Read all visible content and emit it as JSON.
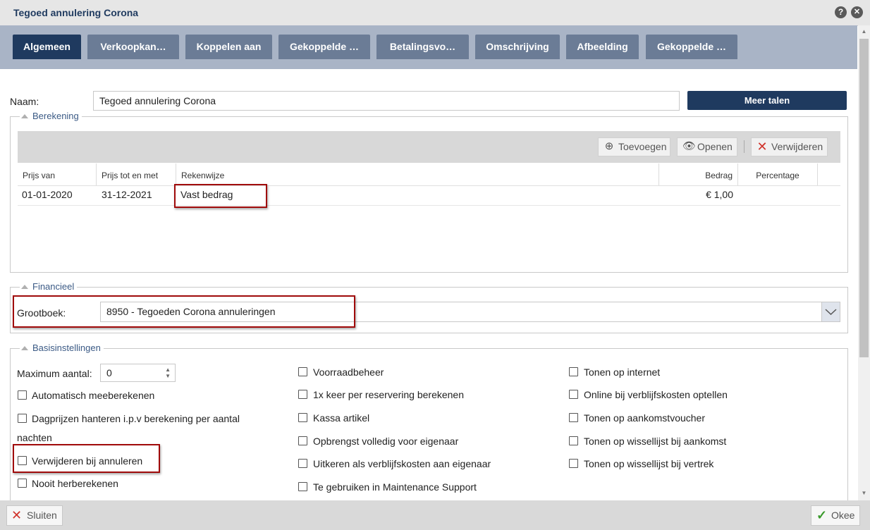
{
  "window": {
    "title": "Tegoed annulering Corona",
    "help_glyph": "?",
    "close_glyph": "✕"
  },
  "tabs": [
    "Algemeen",
    "Verkoopkan…",
    "Koppelen aan",
    "Gekoppelde …",
    "Betalingsvo…",
    "Omschrijving",
    "Afbeelding",
    "Gekoppelde …"
  ],
  "naam": {
    "label": "Naam:",
    "value": "Tegoed annulering Corona",
    "more_languages": "Meer talen"
  },
  "berekening": {
    "legend": "Berekening",
    "toolbar": {
      "add": "Toevoegen",
      "open": "Openen",
      "delete": "Verwijderen"
    },
    "columns": [
      "Prijs van",
      "Prijs tot en met",
      "Rekenwijze",
      "Bedrag",
      "Percentage"
    ],
    "rows": [
      {
        "from": "01-01-2020",
        "to": "31-12-2021",
        "method": "Vast bedrag",
        "amount": "€ 1,00",
        "percentage": ""
      }
    ]
  },
  "financieel": {
    "legend": "Financieel",
    "label": "Grootboek:",
    "value": "8950 - Tegoeden Corona annuleringen"
  },
  "basis": {
    "legend": "Basisinstellingen",
    "max_label": "Maximum aantal:",
    "max_value": "0",
    "col1": [
      "Automatisch meeberekenen",
      "Dagprijzen hanteren i.p.v berekening per aantal",
      "nachten",
      "Verwijderen bij annuleren",
      "Nooit herberekenen"
    ],
    "col2": [
      "Voorraadbeheer",
      "1x keer per reservering berekenen",
      "Kassa artikel",
      "Opbrengst volledig voor eigenaar",
      "Uitkeren als verblijfskosten aan eigenaar",
      "Te gebruiken in Maintenance Support"
    ],
    "col3": [
      "Tonen op internet",
      "Online bij verblijfskosten optellen",
      "Tonen op aankomstvoucher",
      "Tonen op wissellijst bij aankomst",
      "Tonen op wissellijst bij vertrek"
    ]
  },
  "footer": {
    "close": "Sluiten",
    "ok": "Okee"
  },
  "colors": {
    "brand": "#1f3a5f",
    "tab": "#6b7c96",
    "tabbar": "#a9b4c6",
    "highlight": "#a00a0a"
  }
}
